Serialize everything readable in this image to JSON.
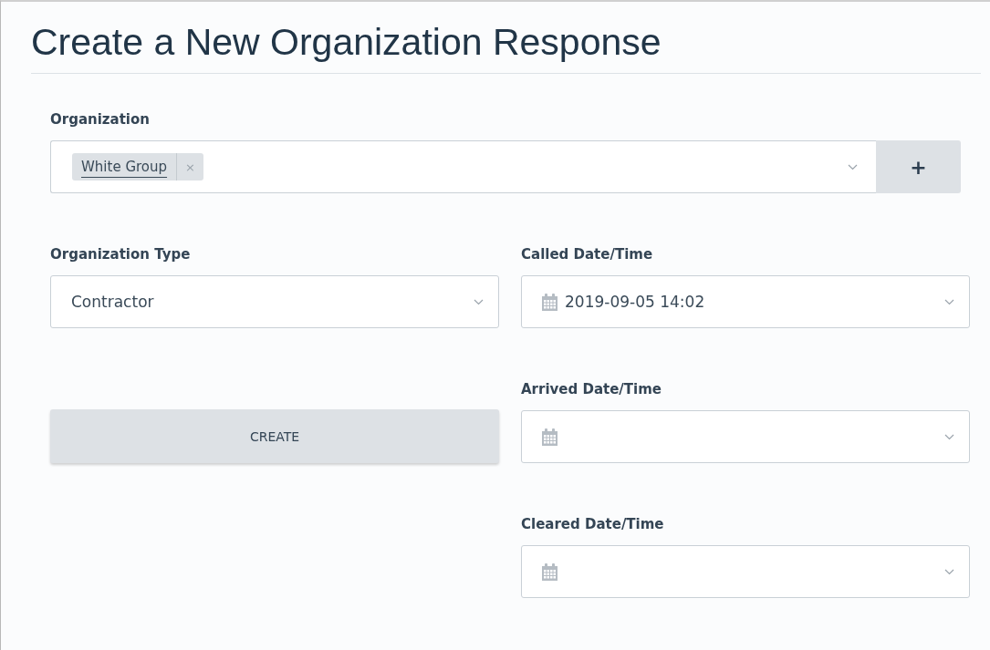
{
  "title": "Create a New Organization Response",
  "organization": {
    "label": "Organization",
    "tags": [
      {
        "label": "White Group",
        "remove": "×"
      }
    ],
    "add_button": "+"
  },
  "organization_type": {
    "label": "Organization Type",
    "value": "Contractor"
  },
  "create_button": "CREATE",
  "date_fields": [
    {
      "label": "Called Date/Time",
      "value": "2019-09-05 14:02"
    },
    {
      "label": "Arrived Date/Time"
    },
    {
      "label": "Cleared Date/Time"
    }
  ]
}
